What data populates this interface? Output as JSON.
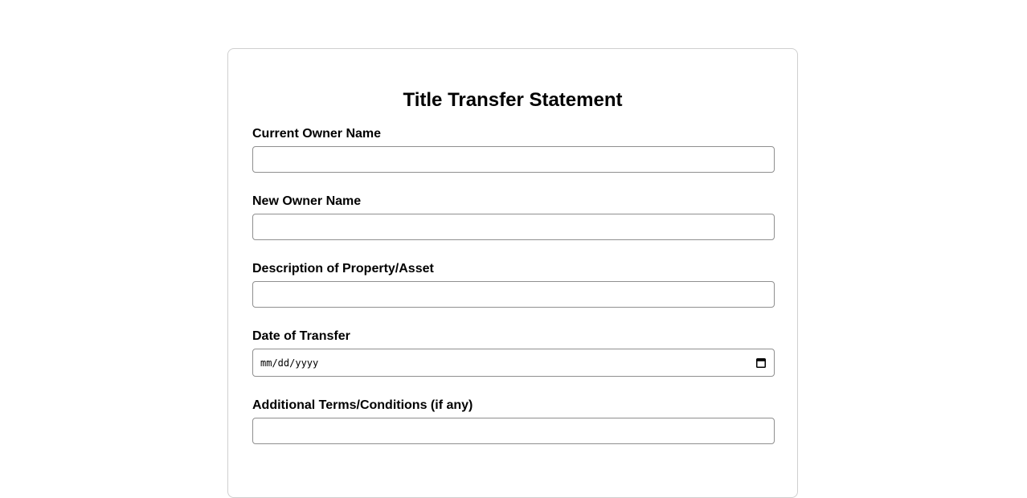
{
  "form": {
    "title": "Title Transfer Statement",
    "fields": [
      {
        "label": "Current Owner Name",
        "value": ""
      },
      {
        "label": "New Owner Name",
        "value": ""
      },
      {
        "label": "Description of Property/Asset",
        "value": ""
      },
      {
        "label": "Date of Transfer",
        "placeholder": "mm/dd/yyyy",
        "icon": "calendar-icon"
      },
      {
        "label": "Additional Terms/Conditions (if any)",
        "value": ""
      }
    ]
  }
}
